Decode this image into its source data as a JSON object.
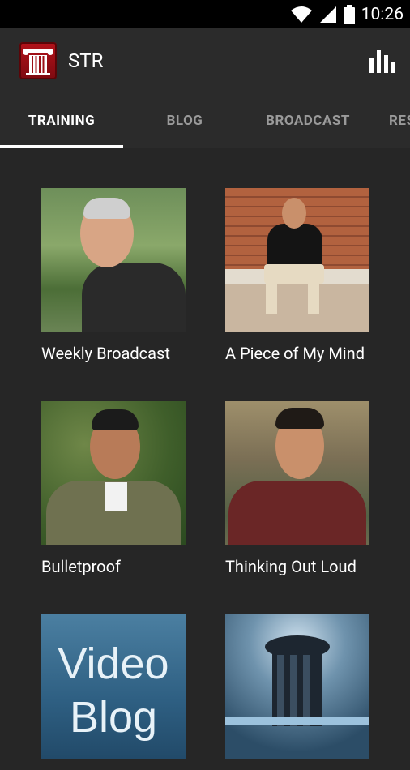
{
  "status": {
    "time": "10:26"
  },
  "app": {
    "title": "STR"
  },
  "tabs": [
    {
      "label": "TRAINING",
      "active": true
    },
    {
      "label": "BLOG",
      "active": false
    },
    {
      "label": "BROADCAST",
      "active": false
    },
    {
      "label": "RES",
      "active": false
    }
  ],
  "cards": [
    {
      "title": "Weekly Broadcast"
    },
    {
      "title": "A Piece of My Mind"
    },
    {
      "title": "Bulletproof"
    },
    {
      "title": "Thinking Out Loud"
    },
    {
      "title": ""
    },
    {
      "title": ""
    }
  ],
  "video_blog": {
    "line1": "Video",
    "line2": "Blog"
  },
  "colors": {
    "accent": "#ffffff",
    "background": "#262626",
    "toolbar": "#2b2b2b"
  },
  "icons": [
    "wifi-icon",
    "signal-icon",
    "battery-icon",
    "bar-chart-icon",
    "column-logo-icon"
  ]
}
